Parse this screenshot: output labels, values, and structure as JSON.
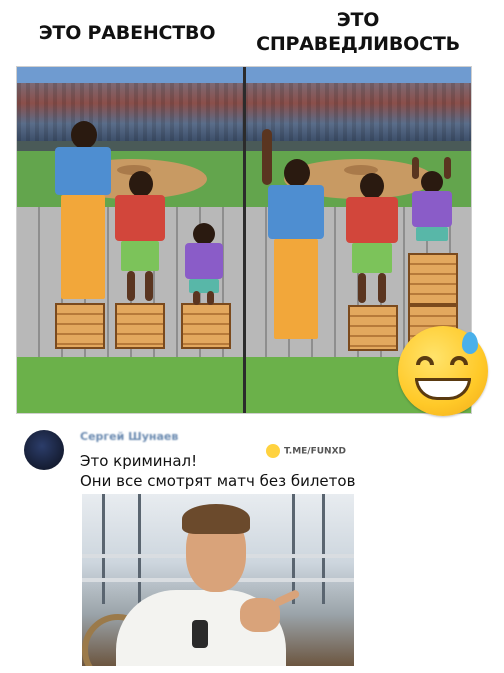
{
  "headings": {
    "left": "ЭТО РАВЕНСТВО",
    "right_line1": "ЭТО",
    "right_line2": "СПРАВЕДЛИВОСТЬ"
  },
  "comment": {
    "user_name": "Сергей Шунаев",
    "line1": "Это криминал!",
    "line2": "Они все смотрят матч без билетов"
  },
  "watermark": "T.ME/FUNXD",
  "colors": {
    "shirt_blue": "#4e8ed1",
    "shirt_red": "#d2463b",
    "shirt_purple": "#8a5cc8",
    "pants_orange": "#f2a73a",
    "pants_green": "#7cc35a",
    "pants_teal": "#58b7a8"
  },
  "icons": {
    "emoji": "sweat-smile-emoji",
    "watermark_icon": "laughing-emoji-icon"
  }
}
